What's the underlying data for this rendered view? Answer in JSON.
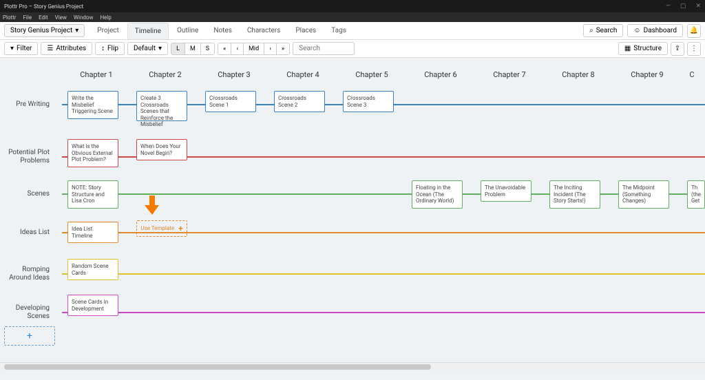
{
  "titlebar": {
    "title": "Plottr Pro – Story Genius Project"
  },
  "menubar": [
    "Plottr",
    "File",
    "Edit",
    "View",
    "Window",
    "Help"
  ],
  "topnav": {
    "project_selector": "Story Genius Project",
    "tabs": [
      "Project",
      "Timeline",
      "Outline",
      "Notes",
      "Characters",
      "Places",
      "Tags"
    ],
    "active_tab": 1,
    "search_label": "Search",
    "dashboard_label": "Dashboard"
  },
  "toolbar": {
    "filter": "Filter",
    "attributes": "Attributes",
    "flip": "Flip",
    "default": "Default",
    "zoom": [
      "L",
      "M",
      "S"
    ],
    "zoom_active": 0,
    "nav": [
      "«",
      "‹",
      "Mid",
      "›",
      "»"
    ],
    "search_placeholder": "Search",
    "structure": "Structure"
  },
  "chapters": [
    "Chapter 1",
    "Chapter 2",
    "Chapter 3",
    "Chapter 4",
    "Chapter 5",
    "Chapter 6",
    "Chapter 7",
    "Chapter 8",
    "Chapter 9",
    "C"
  ],
  "rows": {
    "prewriting": {
      "label": "Pre Writing",
      "color": "blue",
      "cards": [
        {
          "col": 0,
          "text": "Write the Misbelief Triggering Scene"
        },
        {
          "col": 1,
          "text": "Create 3 Crossroads Scenes that Reinforce the Misbelief"
        },
        {
          "col": 2,
          "text": "Crossroads Scene 1"
        },
        {
          "col": 3,
          "text": "Crossroads Scene 2"
        },
        {
          "col": 4,
          "text": "Crossroads Scene 3"
        }
      ]
    },
    "plotproblems": {
      "label": "Potential Plot Problems",
      "color": "red",
      "cards": [
        {
          "col": 0,
          "text": "What is the Obvious External Plot Problem?"
        },
        {
          "col": 1,
          "text": "When Does Your Novel Begin?"
        }
      ]
    },
    "scenes": {
      "label": "Scenes",
      "color": "green",
      "cards": [
        {
          "col": 0,
          "text": "NOTE: Story Structure and Lisa Cron"
        },
        {
          "col": 5,
          "text": "Floating in the Ocean (The Ordinary World)"
        },
        {
          "col": 6,
          "text": "The Unavoidable Problem"
        },
        {
          "col": 7,
          "text": "The Inciting Incident (The Story Starts!)"
        },
        {
          "col": 8,
          "text": "The Midpoint (Something Changes)"
        },
        {
          "col": 9,
          "text": "Th (the Get"
        }
      ]
    },
    "ideas": {
      "label": "Ideas List",
      "color": "orange",
      "cards": [
        {
          "col": 0,
          "text": "Idea List Timeline"
        }
      ],
      "template_card": {
        "col": 1,
        "text": "Use Template"
      }
    },
    "romping": {
      "label": "Romping Around Ideas",
      "color": "yellow",
      "cards": [
        {
          "col": 0,
          "text": "Random Scene Cards"
        }
      ]
    },
    "developing": {
      "label": "Developing Scenes",
      "color": "magenta",
      "cards": [
        {
          "col": 0,
          "text": "Scene Cards in Development"
        }
      ]
    }
  }
}
